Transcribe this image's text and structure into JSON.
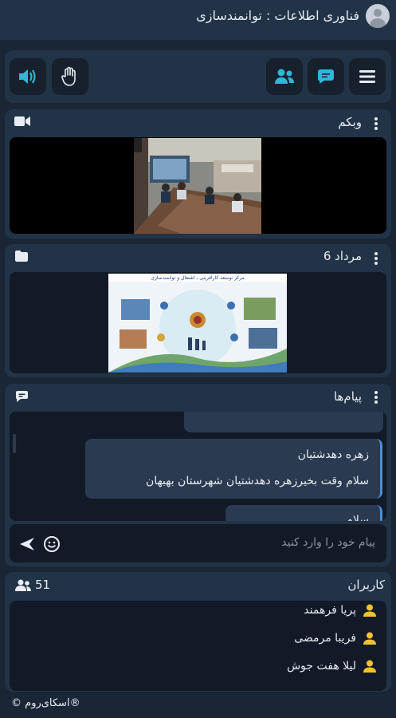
{
  "header": {
    "title": "فناوری اطلاعات : توانمندسازی"
  },
  "webcam": {
    "title": "وبکم"
  },
  "document": {
    "title": "مرداد 6",
    "slide_caption": "مرکز توسعه کارآفرینی ، اشتغال و توانمندسازی"
  },
  "chat": {
    "title": "پیام‌ها",
    "messages": [
      {
        "sender": "زهره دهدشتیان",
        "text": "سلام وقت بخیرزهره دهدشتیان شهرستان بهبهان"
      },
      {
        "text": "سلام ..."
      }
    ],
    "input_placeholder": "پیام خود را وارد کنید"
  },
  "users": {
    "title": "کاربران",
    "count": "51",
    "list": [
      "پریا فرهمند",
      "فریبا مرمضی",
      "لیلا هفت جوش"
    ]
  },
  "footer": {
    "brand": "اسکای‌روم",
    "copyright": "©",
    "registered": "®"
  },
  "colors": {
    "accent": "#31b6d8",
    "user_icon": "#f2c230",
    "background": "#1a2535",
    "panel": "#223247"
  }
}
